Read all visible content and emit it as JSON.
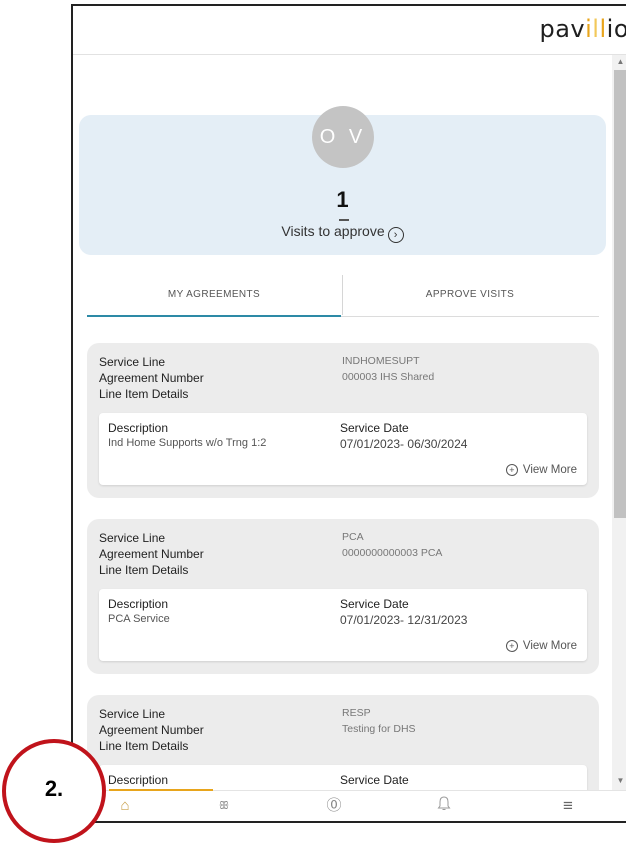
{
  "header": {
    "logo": {
      "part1": "pav",
      "part2": "i",
      "part3": "l",
      "part4": "l",
      "part5": "i",
      "part6": "o"
    }
  },
  "summary": {
    "initials": "O V",
    "count": "1",
    "label": "Visits to approve",
    "arrow": "›"
  },
  "tabs": [
    {
      "label": "MY AGREEMENTS",
      "active": true
    },
    {
      "label": "APPROVE VISITS",
      "active": false
    }
  ],
  "labels": {
    "service_line": "Service Line",
    "agreement_number": "Agreement Number",
    "line_item_details": "Line Item Details",
    "description": "Description",
    "service_date": "Service Date",
    "view_more": "View More"
  },
  "cards": [
    {
      "service_line": "INDHOMESUPT",
      "agreement_number": "000003 IHS Shared",
      "description": "Ind Home Supports w/o Trng 1:2",
      "service_date": "07/01/2023- 06/30/2024"
    },
    {
      "service_line": "PCA",
      "agreement_number": "0000000000003 PCA",
      "description": "PCA Service",
      "service_date": "07/01/2023- 12/31/2023"
    },
    {
      "service_line": "RESP",
      "agreement_number": "Testing for DHS",
      "description": "",
      "service_date": ""
    }
  ],
  "nav": {
    "items": [
      {
        "icon": "home-icon",
        "glyph": "⌂"
      },
      {
        "icon": "people-icon",
        "glyph": "ꕥ"
      },
      {
        "icon": "support-icon",
        "glyph": "⓪"
      },
      {
        "icon": "bell-icon",
        "glyph": "♫"
      },
      {
        "icon": "menu-icon",
        "glyph": "≡"
      }
    ]
  },
  "annotation": {
    "step": "2."
  },
  "colors": {
    "accent": "#e8a51c",
    "tab_underline": "#2d8aa6",
    "summary_bg": "#e4eef6",
    "marker": "#c0131b"
  }
}
